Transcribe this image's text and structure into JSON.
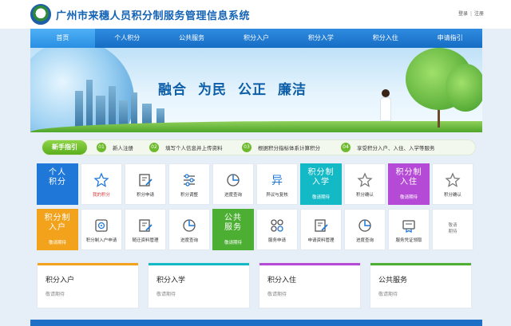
{
  "header": {
    "title": "广州市来穗人员积分制服务管理信息系统",
    "login": "登录",
    "register": "注册",
    "separator": "|"
  },
  "nav": [
    {
      "label": "首页",
      "active": true
    },
    {
      "label": "个人积分"
    },
    {
      "label": "公共服务"
    },
    {
      "label": "积分入户"
    },
    {
      "label": "积分入学"
    },
    {
      "label": "积分入住"
    },
    {
      "label": "申请指引"
    }
  ],
  "banner": {
    "slogan": [
      "融合",
      "为民",
      "公正",
      "廉洁"
    ]
  },
  "guide": {
    "badge": "新手指引",
    "steps": [
      {
        "num": "01",
        "text": "新人注册"
      },
      {
        "num": "02",
        "text": "填写个人信息并上传资料"
      },
      {
        "num": "03",
        "text": "根据积分指标体系计算积分"
      },
      {
        "num": "04",
        "text": "享受积分入户、入住、入学等服务"
      }
    ]
  },
  "tiles": {
    "row1": [
      {
        "type": "big",
        "color": "#1f78d8",
        "title_l1": "个人",
        "title_l2": "积分",
        "sub": ""
      },
      {
        "type": "icon",
        "icon": "star-icon",
        "label": "我的积分",
        "red": true
      },
      {
        "type": "icon",
        "icon": "edit-icon",
        "label": "积分申请"
      },
      {
        "type": "icon",
        "icon": "sliders-icon",
        "label": "积分调整"
      },
      {
        "type": "icon",
        "icon": "pie-chart-icon",
        "label": "进度查询"
      },
      {
        "type": "icon",
        "icon": "objection-icon",
        "label": "异议与复核"
      },
      {
        "type": "big",
        "color": "#14b9c6",
        "title_l1": "积分制",
        "title_l2": "入学",
        "sub": "敬请期待"
      },
      {
        "type": "icon",
        "icon": "star-icon",
        "label": "积分确认"
      },
      {
        "type": "big",
        "color": "#b54ad6",
        "title_l1": "积分制",
        "title_l2": "入住",
        "sub": "敬请期待"
      },
      {
        "type": "icon",
        "icon": "star-icon",
        "label": "积分确认"
      }
    ],
    "row2": [
      {
        "type": "big",
        "color": "#f2a21b",
        "title_l1": "积分制",
        "title_l2": "入户",
        "sub": "敬请期待"
      },
      {
        "type": "icon",
        "icon": "safe-icon",
        "label": "积分制入户申请"
      },
      {
        "type": "icon",
        "icon": "edit-icon",
        "label": "随迁资料管理"
      },
      {
        "type": "icon",
        "icon": "pie-chart-icon",
        "label": "进度查询"
      },
      {
        "type": "big",
        "color": "#4cae33",
        "title_l1": "公共",
        "title_l2": "服务",
        "sub": "敬请期待"
      },
      {
        "type": "icon",
        "icon": "grid-icon",
        "label": "服务申请"
      },
      {
        "type": "icon",
        "icon": "edit-icon",
        "label": "申请资料管理"
      },
      {
        "type": "icon",
        "icon": "pie-chart-icon",
        "label": "进度查询"
      },
      {
        "type": "icon",
        "icon": "certificate-icon",
        "label": "服务凭证领取"
      },
      {
        "type": "plain",
        "label_l1": "敬请",
        "label_l2": "期待"
      }
    ]
  },
  "cards": [
    {
      "title": "积分入户",
      "sub": "敬请期待",
      "color": "#f2a21b"
    },
    {
      "title": "积分入学",
      "sub": "敬请期待",
      "color": "#14b9c6"
    },
    {
      "title": "积分入住",
      "sub": "敬请期待",
      "color": "#b54ad6"
    },
    {
      "title": "公共服务",
      "sub": "敬请期待",
      "color": "#4cae33"
    }
  ],
  "colors": {
    "nav": "#1a74cc",
    "accent_green": "#6dbb2c",
    "title_blue": "#1463b5"
  }
}
